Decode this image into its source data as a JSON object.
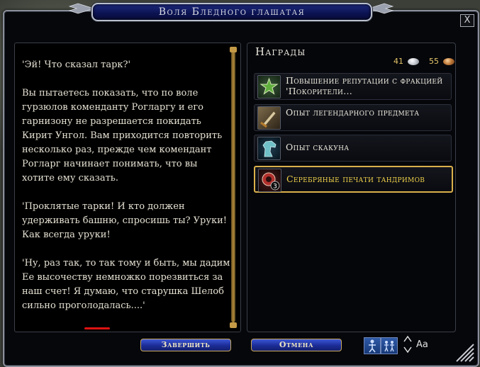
{
  "window": {
    "title": "Воля Бледного глашатая",
    "close_label": "X"
  },
  "story": {
    "text": "'Эй! Что сказал тарк?'\n\nВы пытаетесь показать, что по воле гурзюлов коменданту Рогларгу и его гарнизону не разрешается покидать Кирит Унгол. Вам приходится повторить несколько раз, прежде чем комендант Рогларг начинает понимать, что вы хотите ему сказать.\n\n'Проклятые тарки! И кто должен удерживать башню, спросишь ты? Уруки! Как всегда уруки!\n\n'Ну, раз так, то так тому и быть, мы дадим Ее высочеству немножко порезвиться за наш счет! Я думаю, что старушка Шелоб сильно проголодалась....'"
  },
  "rewards": {
    "title": "Награды",
    "silver_coins": "41",
    "copper_coins": "55",
    "items": [
      {
        "label": "Повышение репутации с фракцией 'Покорители...",
        "icon": "reputation-star-icon"
      },
      {
        "label": "Опыт легендарного предмета",
        "icon": "legendary-item-icon"
      },
      {
        "label": "Опыт скакуна",
        "icon": "horse-head-icon"
      },
      {
        "label": "Серебряные печати тандримов",
        "icon": "silver-seal-icon",
        "badge": "3",
        "selected": true
      }
    ]
  },
  "buttons": {
    "finish": "Завершить",
    "cancel": "Отмена"
  },
  "toolbar": {
    "font_size_label": "Aa"
  },
  "colors": {
    "title_bar": "#0b1250",
    "button_border": "#c9a959",
    "selected_reward_text": "#f1d24a",
    "selected_reward_border": "#d9b04a",
    "annotation_underline": "#dd1111"
  }
}
